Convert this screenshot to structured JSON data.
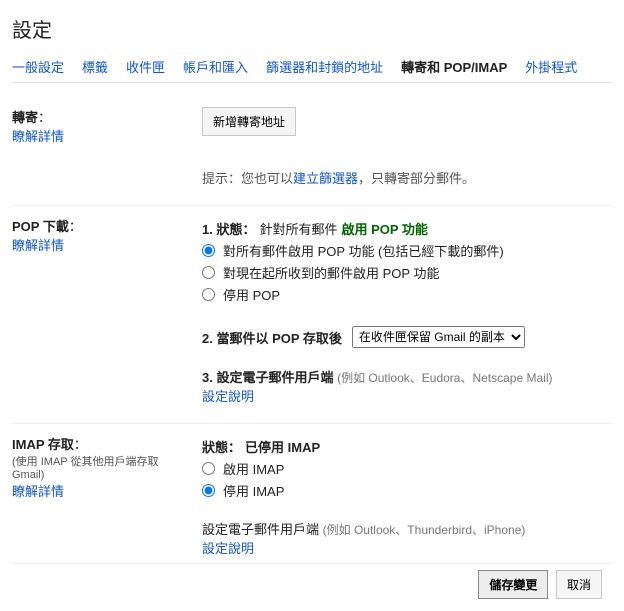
{
  "page_title": "設定",
  "tabs": {
    "general": "一般設定",
    "labels": "標籤",
    "inbox": "收件匣",
    "accounts": "帳戶和匯入",
    "filters": "篩選器和封鎖的地址",
    "forwarding": "轉寄和 POP/IMAP",
    "addons": "外掛程式"
  },
  "forward": {
    "title": "轉寄",
    "colon": "：",
    "learn_more": "瞭解詳情",
    "add_address_btn": "新增轉寄地址",
    "hint_prefix": "提示：您也可以",
    "hint_link": "建立篩選器",
    "hint_suffix": "，只轉寄部分郵件。"
  },
  "pop": {
    "title": "POP 下載",
    "colon": "：",
    "learn_more": "瞭解詳情",
    "status_label": "1. 狀態：",
    "status_prefix": "針對所有郵件",
    "status_enabled": "啟用 POP 功能",
    "opt_all": "對所有郵件啟用 POP 功能 (包括已經下載的郵件)",
    "opt_now": "對現在起所收到的郵件啟用 POP 功能",
    "opt_disable": "停用 POP",
    "when_label": "2. 當郵件以 POP 存取後",
    "when_option": "在收件匣保留 Gmail 的副本",
    "client_label": "3. 設定電子郵件用戶端 ",
    "client_examples": "(例如 Outlook、Eudora、Netscape Mail)",
    "client_help": "設定說明"
  },
  "imap": {
    "title": "IMAP 存取",
    "colon": "：",
    "subtitle": "(使用 IMAP 從其他用戶端存取 Gmail)",
    "learn_more": "瞭解詳情",
    "status_label": "狀態：",
    "status_value": "已停用 IMAP",
    "opt_enable": "啟用 IMAP",
    "opt_disable": "停用 IMAP",
    "client_label": "設定電子郵件用戶端 ",
    "client_examples": "(例如 Outlook、Thunderbird、iPhone)",
    "client_help": "設定說明"
  },
  "footer": {
    "save": "儲存變更",
    "cancel": "取消"
  }
}
